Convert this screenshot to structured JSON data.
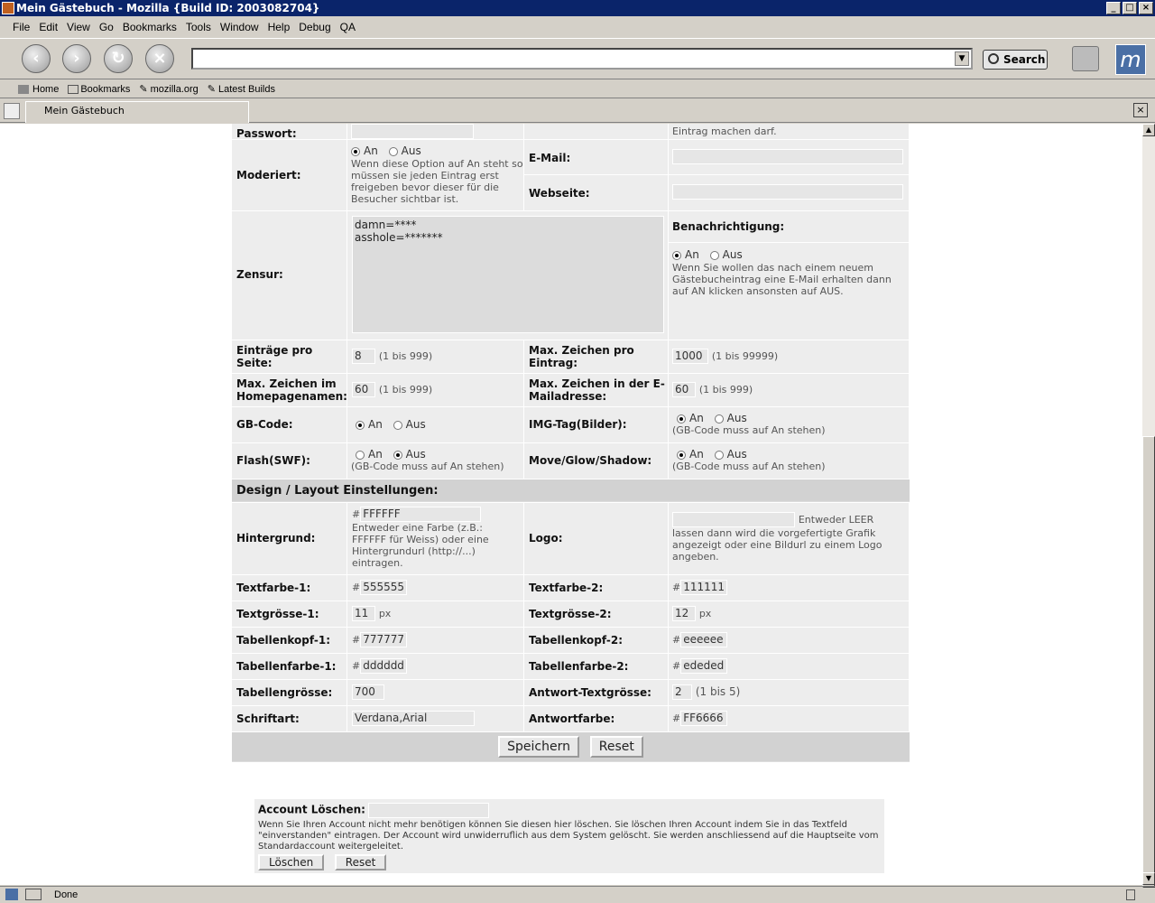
{
  "window": {
    "title": "Mein Gästebuch - Mozilla {Build ID: 2003082704}"
  },
  "menu": [
    "File",
    "Edit",
    "View",
    "Go",
    "Bookmarks",
    "Tools",
    "Window",
    "Help",
    "Debug",
    "QA"
  ],
  "nav": {
    "search_label": "Search"
  },
  "personal": [
    "Home",
    "Bookmarks",
    "mozilla.org",
    "Latest Builds"
  ],
  "tab": {
    "title": "Mein Gästebuch"
  },
  "status": {
    "text": "Done"
  },
  "form": {
    "passwort_label": "Passwort:",
    "passwort_note": "Eintrag machen darf.",
    "moderiert": {
      "label": "Moderiert:",
      "on": "An",
      "off": "Aus",
      "note": "Wenn diese Option auf An steht so müssen sie jeden Eintrag erst freigeben bevor dieser für die Besucher sichtbar ist."
    },
    "email_label": "E-Mail:",
    "webseite_label": "Webseite:",
    "zensur": {
      "label": "Zensur:",
      "text": "damn=****\nasshole=*******"
    },
    "benach": {
      "label": "Benachrichtigung:",
      "on": "An",
      "off": "Aus",
      "note": "Wenn Sie wollen das nach einem neuem Gästebucheintrag eine E-Mail erhalten dann auf AN klicken ansonsten auf AUS."
    },
    "eintraege": {
      "label": "Einträge pro Seite:",
      "value": "8",
      "hint": "(1 bis 999)"
    },
    "maxzeichen": {
      "label": "Max. Zeichen pro Eintrag:",
      "value": "1000",
      "hint": "(1 bis 99999)"
    },
    "maxhome": {
      "label": "Max. Zeichen im Homepagenamen:",
      "value": "60",
      "hint": "(1 bis 999)"
    },
    "maxmail": {
      "label": "Max. Zeichen in der E-Mailadresse:",
      "value": "60",
      "hint": "(1 bis 999)"
    },
    "gbcode": {
      "label": "GB-Code:",
      "on": "An",
      "off": "Aus"
    },
    "imgtag": {
      "label": "IMG-Tag(Bilder):",
      "on": "An",
      "off": "Aus",
      "note": "(GB-Code muss auf An stehen)"
    },
    "flash": {
      "label": "Flash(SWF):",
      "on": "An",
      "off": "Aus",
      "note": "(GB-Code muss auf An stehen)"
    },
    "move": {
      "label": "Move/Glow/Shadow:",
      "on": "An",
      "off": "Aus",
      "note": "(GB-Code muss auf An stehen)"
    },
    "design_header": "Design / Layout Einstellungen:",
    "hintergrund": {
      "label": "Hintergrund:",
      "value": "FFFFFF",
      "note": "Entweder eine Farbe (z.B.: FFFFFF für Weiss) oder eine Hintergrundurl (http://...) eintragen."
    },
    "logo": {
      "label": "Logo:",
      "note_inline": "Entweder LEER",
      "note": "lassen dann wird die vorgefertigte Grafik angezeigt oder eine Bildurl zu einem Logo angeben."
    },
    "hash": "#",
    "px": "px",
    "textfarbe1": {
      "label": "Textfarbe-1:",
      "value": "555555"
    },
    "textfarbe2": {
      "label": "Textfarbe-2:",
      "value": "111111"
    },
    "textgroesse1": {
      "label": "Textgrösse-1:",
      "value": "11"
    },
    "textgroesse2": {
      "label": "Textgrösse-2:",
      "value": "12"
    },
    "kopf1": {
      "label": "Tabellenkopf-1:",
      "value": "777777"
    },
    "kopf2": {
      "label": "Tabellenkopf-2:",
      "value": "eeeeee"
    },
    "farbe1": {
      "label": "Tabellenfarbe-1:",
      "value": "dddddd"
    },
    "farbe2": {
      "label": "Tabellenfarbe-2:",
      "value": "ededed"
    },
    "tabgroesse": {
      "label": "Tabellengrösse:",
      "value": "700"
    },
    "antwortgroesse": {
      "label": "Antwort-Textgrösse:",
      "value": "2",
      "hint": "(1 bis 5)"
    },
    "schrift": {
      "label": "Schriftart:",
      "value": "Verdana,Arial"
    },
    "antwortfarbe": {
      "label": "Antwortfarbe:",
      "value": "FF6666"
    },
    "save_label": "Speichern",
    "reset_label": "Reset"
  },
  "account": {
    "label": "Account Löschen:",
    "note": "Wenn Sie Ihren Account nicht mehr benötigen können Sie diesen hier löschen. Sie löschen Ihren Account indem Sie in das Textfeld \"einverstanden\" eintragen. Der Account wird unwiderruflich aus dem System gelöscht. Sie werden anschliessend auf die Hauptseite vom Standardaccount weitergeleitet.",
    "delete_label": "Löschen",
    "reset_label": "Reset"
  }
}
